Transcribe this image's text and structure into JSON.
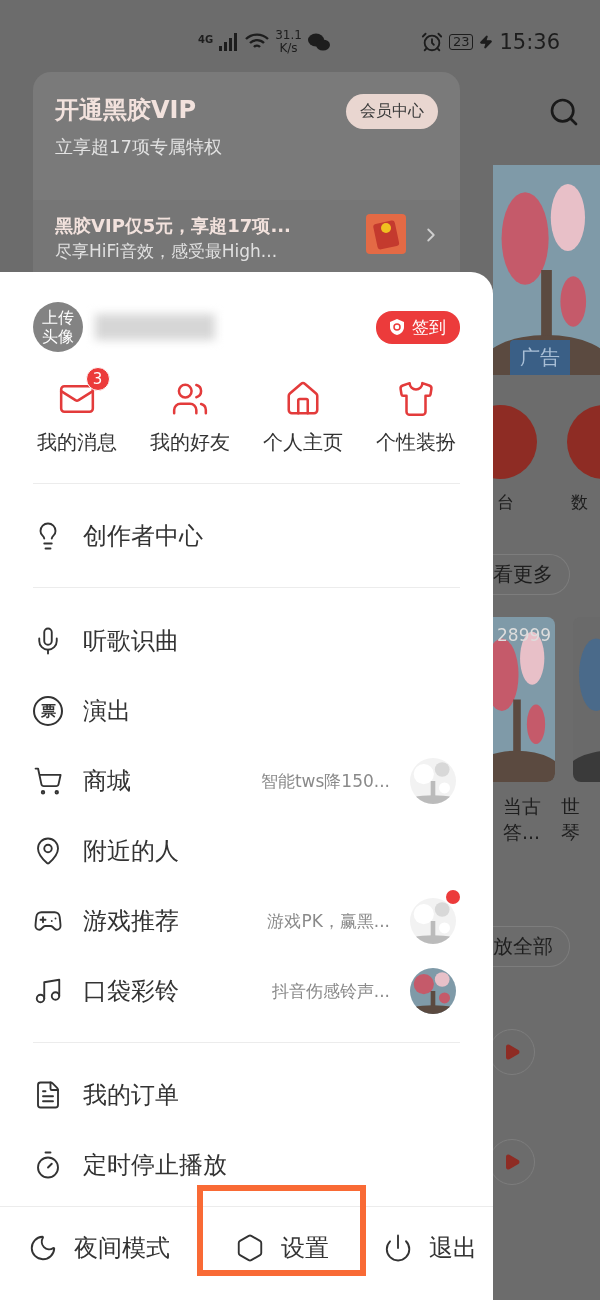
{
  "status_bar": {
    "network": "4G",
    "speed": "31.1",
    "speed_unit": "K/s",
    "battery": "23",
    "time": "15:36"
  },
  "vip_card": {
    "title": "开通黑胶VIP",
    "subtitle": "立享超17项专属特权",
    "button": "会员中心",
    "promo_title": "黑胶VIP仅5元，享超17项...",
    "promo_subtitle": "尽享HiFi音效，感受最High..."
  },
  "drawer": {
    "avatar_label": "上传头像",
    "check_in": "签到",
    "shortcuts": [
      {
        "label": "我的消息",
        "badge": "3"
      },
      {
        "label": "我的好友"
      },
      {
        "label": "个人主页"
      },
      {
        "label": "个性装扮"
      }
    ],
    "creator": "创作者中心",
    "menu": [
      {
        "label": "听歌识曲"
      },
      {
        "label": "演出",
        "icon_glyph": "票"
      },
      {
        "label": "商城",
        "hint": "智能tws降150...",
        "notify": false
      },
      {
        "label": "附近的人"
      },
      {
        "label": "游戏推荐",
        "hint": "游戏PK，赢黑...",
        "notify": true
      },
      {
        "label": "口袋彩铃",
        "hint": "抖音伤感铃声...",
        "notify": false
      }
    ],
    "menu_2": [
      {
        "label": "我的订单"
      },
      {
        "label": "定时停止播放"
      }
    ],
    "footer": [
      {
        "label": "夜间模式",
        "highlighted": false
      },
      {
        "label": "设置",
        "highlighted": true
      },
      {
        "label": "退出",
        "highlighted": false
      }
    ]
  },
  "background_page": {
    "ad_label": "广告",
    "category_labels": [
      "台",
      "数"
    ],
    "more_button": "看更多",
    "play_count": "28999",
    "card_titles": [
      {
        "line_1": "当古",
        "line_2": "答..."
      },
      {
        "line_1": "世",
        "line_2": "琴"
      }
    ],
    "play_all": "放全部"
  }
}
